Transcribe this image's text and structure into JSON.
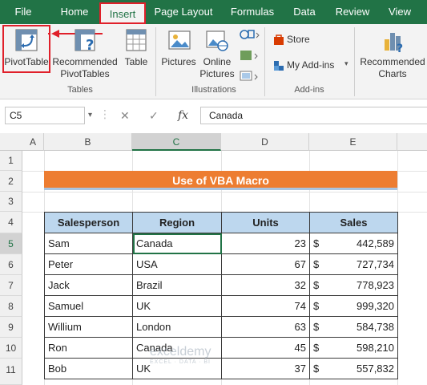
{
  "tabs": [
    "File",
    "Home",
    "Insert",
    "Page Layout",
    "Formulas",
    "Data",
    "Review",
    "View"
  ],
  "ribbon": {
    "pivottable": "PivotTable",
    "recommended_pivot_1": "Recommended",
    "recommended_pivot_2": "PivotTables",
    "table": "Table",
    "group_tables": "Tables",
    "pictures": "Pictures",
    "online_pictures_1": "Online",
    "online_pictures_2": "Pictures",
    "group_illustrations": "Illustrations",
    "store": "Store",
    "my_addins": "My Add-ins",
    "group_addins": "Add-ins",
    "rec_charts_1": "Recommended",
    "rec_charts_2": "Charts"
  },
  "formula_bar": {
    "name_box": "C5",
    "cancel": "✕",
    "enter": "✓",
    "fx": "fx",
    "value": "Canada"
  },
  "columns": [
    "A",
    "B",
    "C",
    "D",
    "E"
  ],
  "rows": [
    "1",
    "2",
    "3",
    "4",
    "5",
    "6",
    "7",
    "8",
    "9",
    "10",
    "11"
  ],
  "sheet": {
    "title": "Use of VBA Macro",
    "headers": [
      "Salesperson",
      "Region",
      "Units",
      "Sales"
    ],
    "records": [
      {
        "salesperson": "Sam",
        "region": "Canada",
        "units": "23",
        "currency": "$",
        "sales": "442,589"
      },
      {
        "salesperson": "Peter",
        "region": "USA",
        "units": "67",
        "currency": "$",
        "sales": "727,734"
      },
      {
        "salesperson": "Jack",
        "region": "Brazil",
        "units": "32",
        "currency": "$",
        "sales": "778,923"
      },
      {
        "salesperson": "Samuel",
        "region": "UK",
        "units": "74",
        "currency": "$",
        "sales": "999,320"
      },
      {
        "salesperson": "Willium",
        "region": "London",
        "units": "63",
        "currency": "$",
        "sales": "584,738"
      },
      {
        "salesperson": "Ron",
        "region": "Canada",
        "units": "45",
        "currency": "$",
        "sales": "598,210"
      },
      {
        "salesperson": "Bob",
        "region": "UK",
        "units": "37",
        "currency": "$",
        "sales": "557,832"
      }
    ]
  },
  "watermark": {
    "name": "exceldemy",
    "tagline": "EXCEL · DATA · BI"
  },
  "colors": {
    "excel_green": "#217346",
    "highlight_red": "#e0202a",
    "title_orange": "#ed7d31",
    "header_blue": "#bdd7ee"
  }
}
